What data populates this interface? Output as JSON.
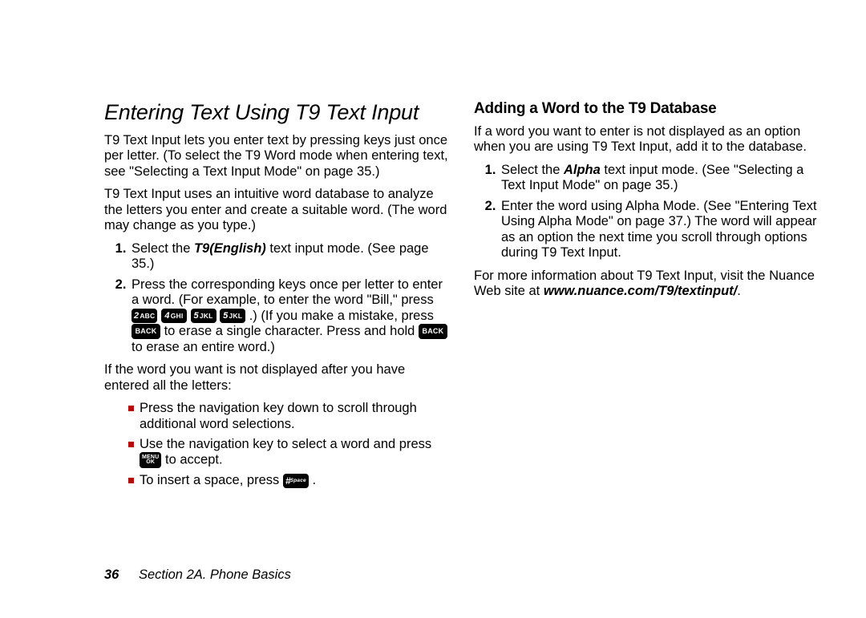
{
  "left": {
    "heading": "Entering Text Using T9 Text Input",
    "p1": "T9 Text Input lets you enter text by pressing keys just once per letter. (To select the T9 Word mode when entering text, see \"Selecting a Text Input Mode\" on page 35.)",
    "p2": "T9 Text Input uses an intuitive word database to analyze the letters you enter and create a suitable word. (The word may change as you type.)",
    "li1_a": "Select the ",
    "li1_mode": "T9(English)",
    "li1_b": " text input mode. (See page 35.)",
    "li2_a": "Press the corresponding keys once per letter to enter a word. (For example, to enter the word \"Bill,\" press ",
    "li2_b": " .) (If you make a mistake, press ",
    "li2_c": " to erase a single character. Press and hold ",
    "li2_d": " to erase an entire word.)",
    "p3": "If the word you want is not displayed after you have entered all the letters:",
    "b1": "Press the navigation key down to scroll through additional word selections.",
    "b2_a": "Use the navigation key to select a word and press ",
    "b2_b": " to accept.",
    "b3_a": "To insert a space, press ",
    "b3_b": " ."
  },
  "right": {
    "heading": "Adding a Word to the T9 Database",
    "p1": "If a word you want to enter is not displayed as an option when you are using T9 Text Input, add it to the database.",
    "li1_a": "Select the ",
    "li1_mode": "Alpha",
    "li1_b": " text input mode. (See \"Selecting a Text Input Mode\" on page 35.)",
    "li2": "Enter the word using Alpha Mode. (See \"Entering Text Using Alpha Mode\" on page 37.) The word will appear as an option the next time you scroll through options during T9 Text Input.",
    "p2_a": "For more information about T9 Text Input, visit the Nuance Web site at ",
    "p2_url": "www.nuance.com/T9/textinput/",
    "p2_b": "."
  },
  "keys": {
    "k2": {
      "d": "2",
      "s": "ABC"
    },
    "k4": {
      "d": "4",
      "s": "GHI"
    },
    "k5": {
      "d": "5",
      "s": "JKL"
    },
    "back": "BACK",
    "menu_top": "MENU",
    "menu_bot": "OK",
    "space_hash": "#",
    "space_txt": "Space"
  },
  "footer": {
    "page": "36",
    "section": "Section 2A. Phone Basics"
  }
}
